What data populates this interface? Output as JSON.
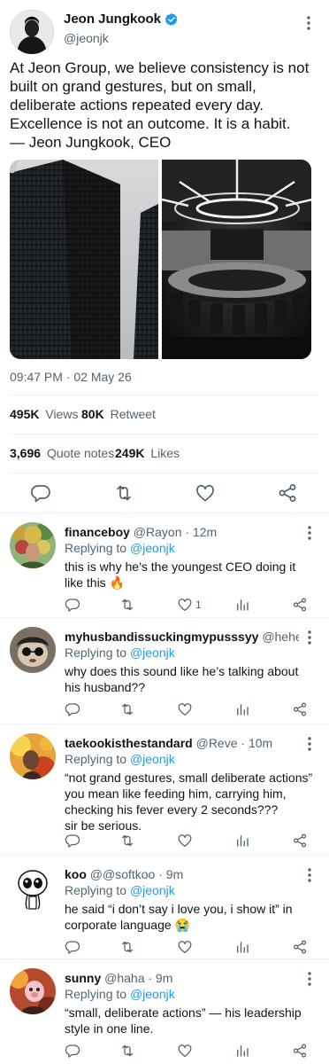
{
  "main": {
    "name": "Jeon Jungkook",
    "handle": "@jeonjk",
    "text": "At Jeon Group, we believe consistency is not built on grand gestures, but on small, deliberate actions repeated every day.\nExcellence is not an outcome. It is a habit.\n— Jeon Jungkook, CEO",
    "timestamp": "09:47 PM · 02 May 26",
    "views_count": "495K",
    "views_label": "Views",
    "retweet_count": "80K",
    "retweet_label": "Retweet",
    "quote_count": "3,696",
    "quote_label": "Quote notes",
    "likes_count": "249K",
    "likes_label": "Likes",
    "images": [
      "office-building-photo",
      "conference-room-photo"
    ]
  },
  "replies": [
    {
      "name": "financeboy",
      "handle": "@Rayon",
      "time": "· 12m",
      "replying_prefix": "Replying to",
      "replying_to": "@jeonjk",
      "text": "this is why he’s the youngest CEO doing it like this 🔥",
      "like_count": "1"
    },
    {
      "name": "myhusbandissuckingmypusssyy",
      "handle": "@hehehe · ...",
      "time": "",
      "replying_prefix": "Replying to",
      "replying_to": "@jeonjk",
      "text": "why does this sound like he’s talking about his husband??",
      "like_count": ""
    },
    {
      "name": "taekookisthestandard",
      "handle": "@Reve",
      "time": "· 10m",
      "replying_prefix": "Replying to",
      "replying_to": "@jeonjk",
      "text": "“not grand gestures, small deliberate actions” you mean like feeding him, carrying him, checking his fever every 2 seconds???\nsir be serious.",
      "like_count": ""
    },
    {
      "name": "koo",
      "handle": "@@softkoo",
      "time": "· 9m",
      "replying_prefix": "Replying to",
      "replying_to": "@jeonjk",
      "text": "he said “i don’t say i love you, i show it” in corporate language 😭",
      "like_count": ""
    },
    {
      "name": "sunny",
      "handle": "@haha",
      "time": "· 9m",
      "replying_prefix": "Replying to",
      "replying_to": "@jeonjk",
      "text": "“small, deliberate actions” — his leadership style in one line.",
      "like_count": ""
    }
  ],
  "colors": {
    "accent": "#1d9bf0",
    "secondary_text": "#536471",
    "primary_text": "#0f1419",
    "divider": "#eff3f4",
    "icon": "#536471"
  },
  "icons": [
    "verified-badge-icon",
    "more-options-icon",
    "reply-icon",
    "retweet-icon",
    "like-icon",
    "share-icon",
    "views-chart-icon"
  ]
}
